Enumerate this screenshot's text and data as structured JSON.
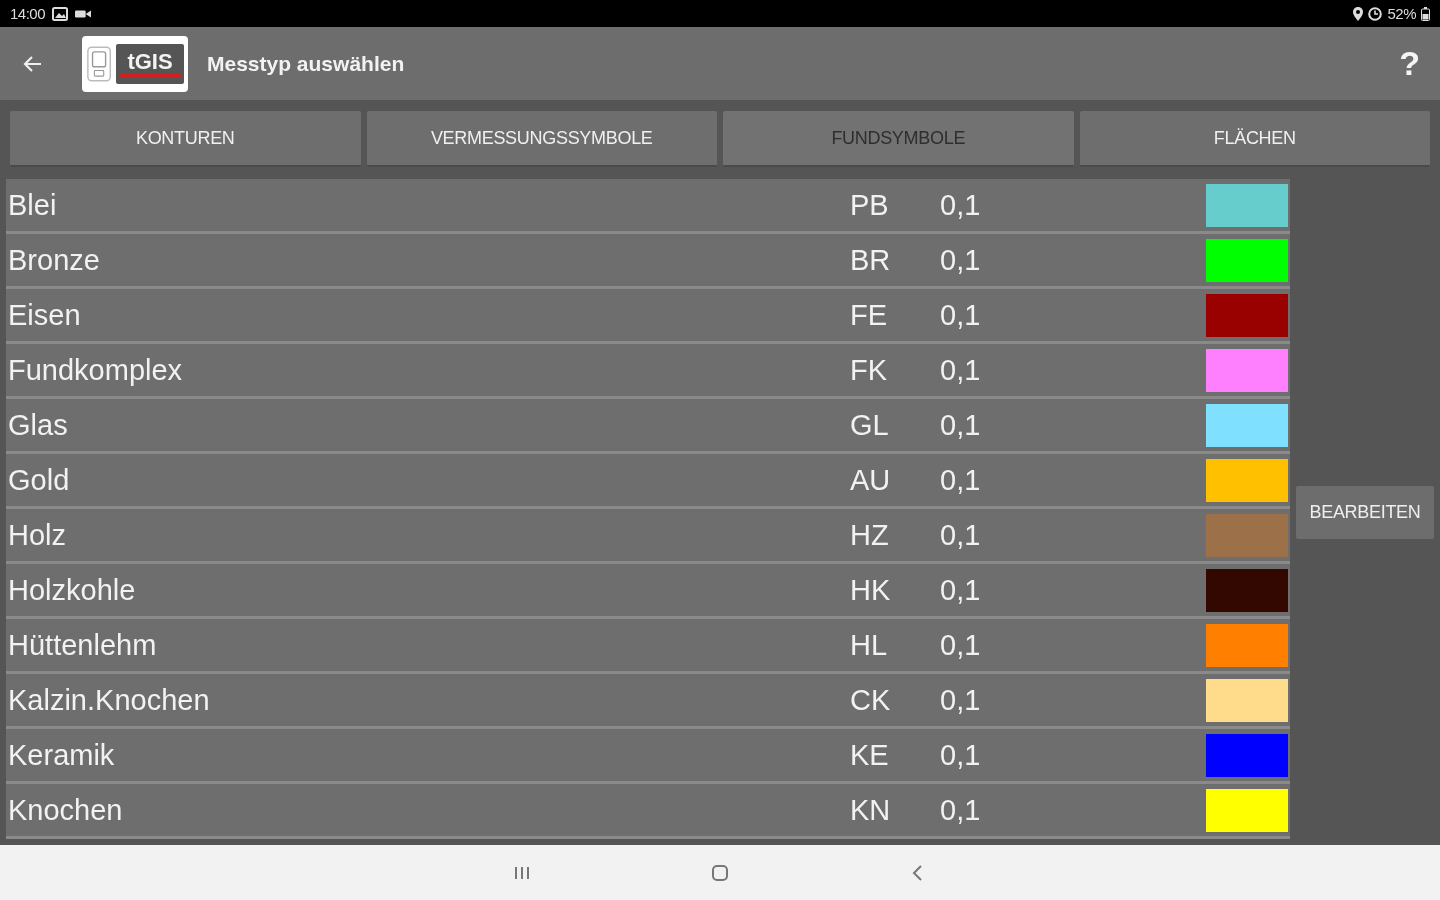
{
  "status_bar": {
    "time": "14:00",
    "battery": "52%"
  },
  "app_bar": {
    "logo_text": "tGIS",
    "title": "Messtyp auswählen",
    "help": "?"
  },
  "tabs": [
    {
      "label": "KONTUREN",
      "selected": false
    },
    {
      "label": "VERMESSUNGSSYMBOLE",
      "selected": false
    },
    {
      "label": "FUNDSYMBOLE",
      "selected": true
    },
    {
      "label": "FLÄCHEN",
      "selected": false
    }
  ],
  "items": [
    {
      "name": "Blei",
      "code": "PB",
      "value": "0,1",
      "color": "#66cccc"
    },
    {
      "name": "Bronze",
      "code": "BR",
      "value": "0,1",
      "color": "#00ff00"
    },
    {
      "name": "Eisen",
      "code": "FE",
      "value": "0,1",
      "color": "#990000"
    },
    {
      "name": "Fundkomplex",
      "code": "FK",
      "value": "0,1",
      "color": "#ff80ff"
    },
    {
      "name": "Glas",
      "code": "GL",
      "value": "0,1",
      "color": "#80e0ff"
    },
    {
      "name": "Gold",
      "code": "AU",
      "value": "0,1",
      "color": "#ffc000"
    },
    {
      "name": "Holz",
      "code": "HZ",
      "value": "0,1",
      "color": "#9c7048"
    },
    {
      "name": "Holzkohle",
      "code": "HK",
      "value": "0,1",
      "color": "#330800"
    },
    {
      "name": "Hüttenlehm",
      "code": "HL",
      "value": "0,1",
      "color": "#ff8000"
    },
    {
      "name": "Kalzin.Knochen",
      "code": "CK",
      "value": "0,1",
      "color": "#ffdc8c"
    },
    {
      "name": "Keramik",
      "code": "KE",
      "value": "0,1",
      "color": "#0000ff"
    },
    {
      "name": "Knochen",
      "code": "KN",
      "value": "0,1",
      "color": "#ffff00"
    }
  ],
  "edit_button": "BEARBEITEN"
}
